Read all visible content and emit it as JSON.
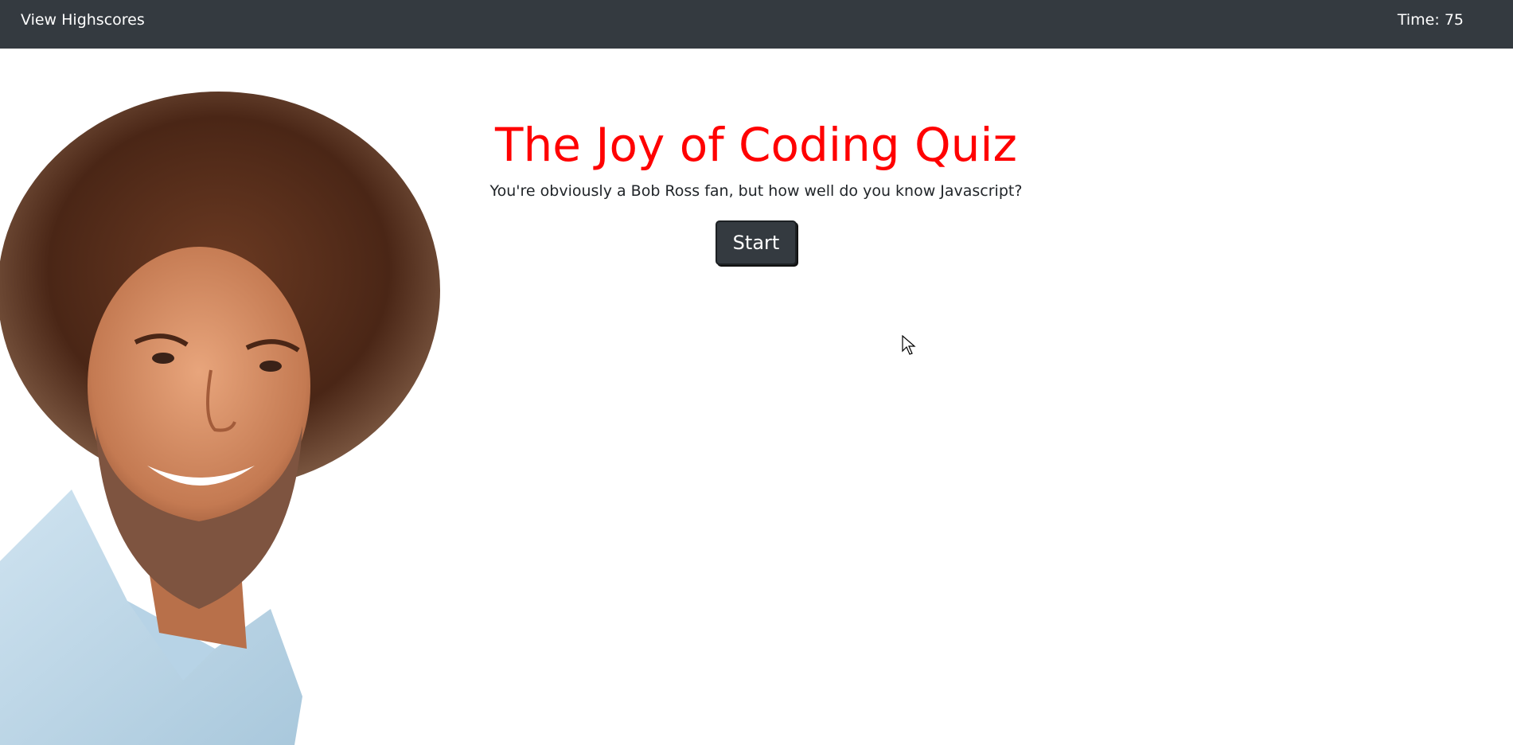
{
  "navbar": {
    "highscores_label": "View Highscores",
    "timer_label": "Time: 75"
  },
  "main": {
    "title": "The Joy of Coding Quiz",
    "subtitle": "You're obviously a Bob Ross fan, but how well do you know Javascript?",
    "start_label": "Start"
  },
  "colors": {
    "navbar_bg": "#343a40",
    "title_color": "#ff0000",
    "button_bg": "#343a40"
  }
}
